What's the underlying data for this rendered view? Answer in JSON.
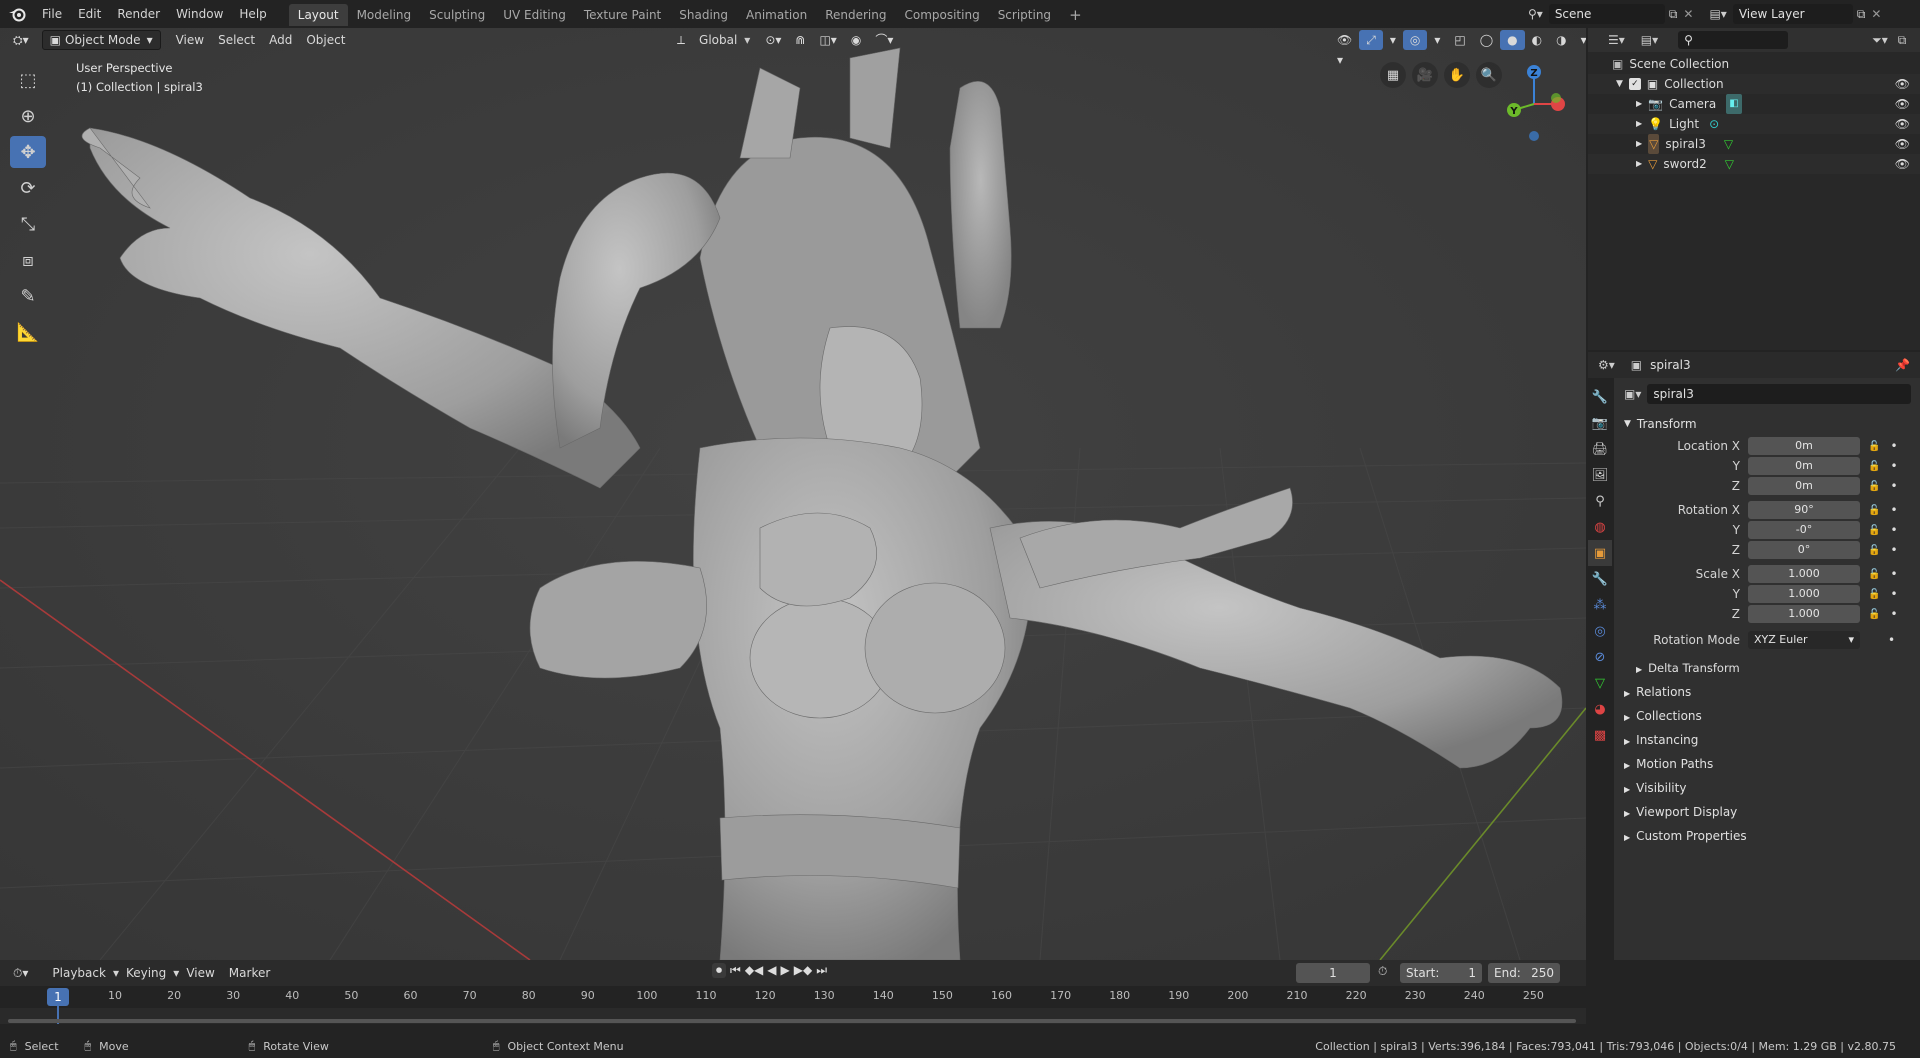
{
  "topbar": {
    "menus": [
      "File",
      "Edit",
      "Render",
      "Window",
      "Help"
    ],
    "workspaces": [
      "Layout",
      "Modeling",
      "Sculpting",
      "UV Editing",
      "Texture Paint",
      "Shading",
      "Animation",
      "Rendering",
      "Compositing",
      "Scripting"
    ],
    "add_tab": "+",
    "scene_name": "Scene",
    "view_layer": "View Layer"
  },
  "viewport": {
    "mode": "Object Mode",
    "menus": [
      "View",
      "Select",
      "Add",
      "Object"
    ],
    "orientation": "Global",
    "overlay_title": "User Perspective",
    "overlay_subtitle": "(1) Collection | spiral3",
    "gizmo": {
      "z": "Z",
      "y": "Y"
    }
  },
  "outliner": {
    "root": "Scene Collection",
    "collection": "Collection",
    "items": [
      {
        "name": "Camera",
        "icon": "camera-icon"
      },
      {
        "name": "Light",
        "icon": "light-icon"
      },
      {
        "name": "spiral3",
        "icon": "mesh-icon"
      },
      {
        "name": "sword2",
        "icon": "mesh-icon"
      }
    ]
  },
  "properties": {
    "header_object": "spiral3",
    "object_name": "spiral3",
    "transform_label": "Transform",
    "rows": [
      {
        "label": "Location X",
        "value": "0m"
      },
      {
        "label": "Y",
        "value": "0m"
      },
      {
        "label": "Z",
        "value": "0m"
      },
      {
        "label": "Rotation X",
        "value": "90°"
      },
      {
        "label": "Y",
        "value": "-0°"
      },
      {
        "label": "Z",
        "value": "0°"
      },
      {
        "label": "Scale X",
        "value": "1.000"
      },
      {
        "label": "Y",
        "value": "1.000"
      },
      {
        "label": "Z",
        "value": "1.000"
      }
    ],
    "rotation_mode_label": "Rotation Mode",
    "rotation_mode_value": "XYZ Euler",
    "delta_transform": "Delta Transform",
    "panels": [
      "Relations",
      "Collections",
      "Instancing",
      "Motion Paths",
      "Visibility",
      "Viewport Display",
      "Custom Properties"
    ]
  },
  "timeline": {
    "menus": [
      "Playback",
      "Keying",
      "View",
      "Marker"
    ],
    "current_frame": "1",
    "start_label": "Start:",
    "start": "1",
    "end_label": "End:",
    "end": "250",
    "ticks": [
      "10",
      "20",
      "30",
      "40",
      "50",
      "60",
      "70",
      "80",
      "90",
      "100",
      "110",
      "120",
      "130",
      "140",
      "150",
      "160",
      "170",
      "180",
      "190",
      "200",
      "210",
      "220",
      "230",
      "240",
      "250"
    ],
    "playhead": "1"
  },
  "statusbar": {
    "select": "Select",
    "move": "Move",
    "rotate_view": "Rotate View",
    "context_menu": "Object Context Menu",
    "stats": "Collection | spiral3 | Verts:396,184 | Faces:793,041 | Tris:793,046 | Objects:0/4 | Mem: 1.29 GB | v2.80.75"
  },
  "colors": {
    "accent": "#4772b3",
    "viewport_bg": "#3d3d3d",
    "x_axis": "#a83a3a",
    "y_axis": "#6a8a2a",
    "gizmo_x": "#e04545",
    "gizmo_y": "#6cba2a",
    "gizmo_z": "#3b82d6"
  }
}
